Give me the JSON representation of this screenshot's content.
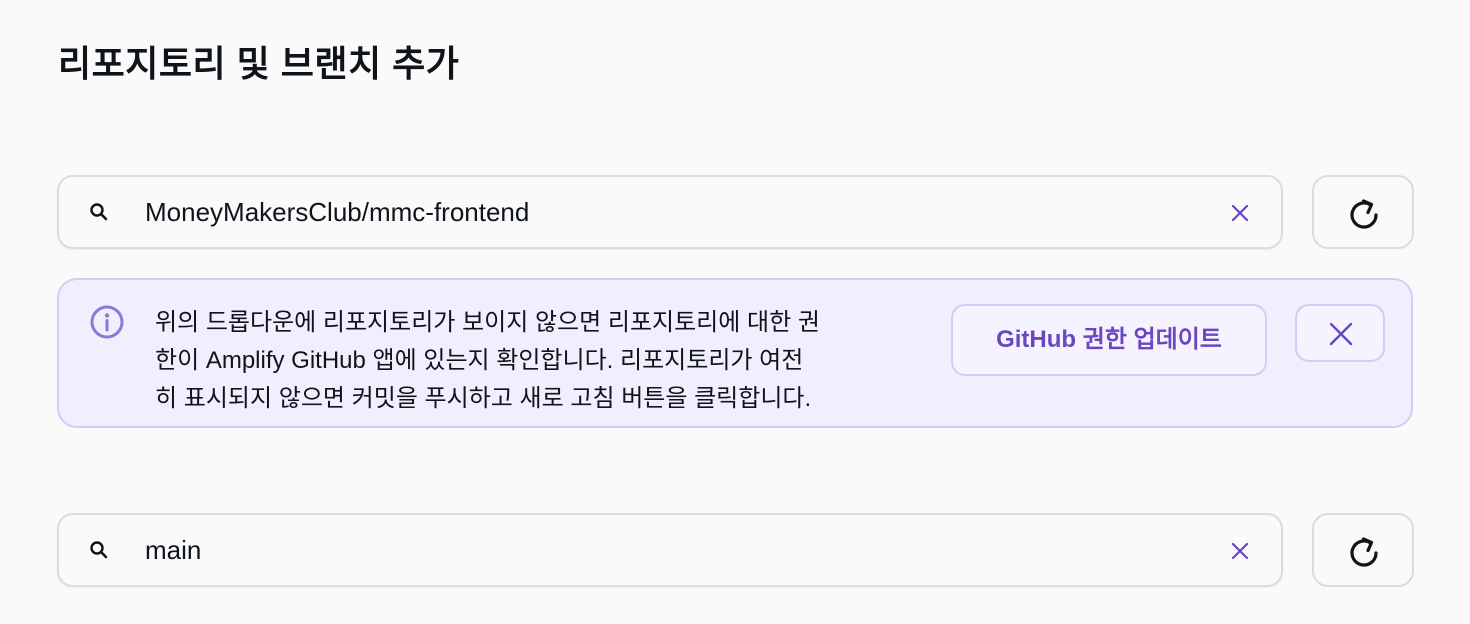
{
  "page": {
    "title": "리포지토리 및 브랜치 추가"
  },
  "repository_search": {
    "value": "MoneyMakersClub/mmc-frontend",
    "search_icon": "search-icon",
    "clear_icon": "close-icon",
    "refresh_icon": "refresh-icon"
  },
  "info_alert": {
    "icon": "info-icon",
    "lines": [
      "위의 드롭다운에 리포지토리가 보이지 않으면 리포지토리에 대한 권",
      "한이 Amplify GitHub 앱에 있는지 확인합니다. 리포지토리가 여전",
      "히 표시되지 않으면 커밋을 푸시하고 새로 고침 버튼을 클릭합니다."
    ],
    "action_label": "GitHub 권한 업데이트",
    "dismiss_icon": "close-icon"
  },
  "branch_search": {
    "value": "main",
    "search_icon": "search-icon",
    "clear_icon": "close-icon",
    "refresh_icon": "refresh-icon"
  },
  "colors": {
    "background": "#fafafa",
    "border": "#dcdcde",
    "accent": "#6b46c1",
    "info_background": "#f1effd",
    "info_border": "#d3ccf5",
    "text": "#0f141a"
  }
}
